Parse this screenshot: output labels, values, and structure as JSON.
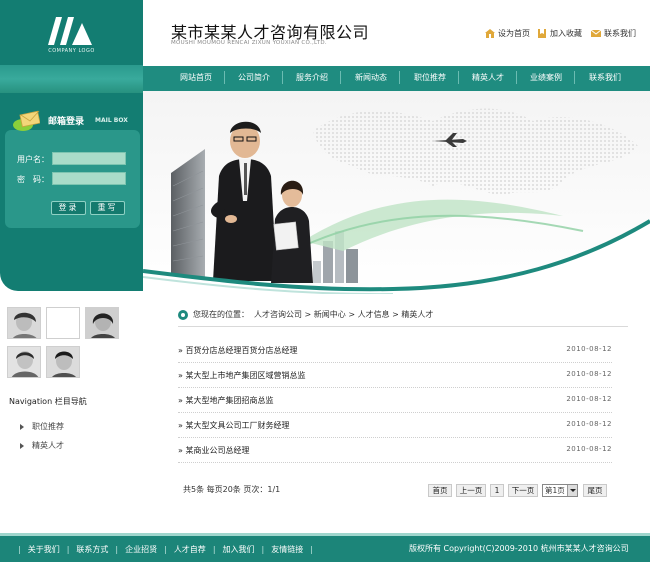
{
  "brand": {
    "logo_text": "COMPANY LOGO",
    "company_name": "某市某某人才咨询有限公司",
    "company_sub": "MOUSHI MOUMOU RENCAI ZIXUN YOUXIAN CO.,LTD.",
    "accent": "#137d72"
  },
  "toplinks": [
    {
      "label": "设为首页",
      "icon": "home-icon"
    },
    {
      "label": "加入收藏",
      "icon": "bookmark-icon"
    },
    {
      "label": "联系我们",
      "icon": "mail-icon"
    }
  ],
  "nav": [
    "网站首页",
    "公司简介",
    "服务介绍",
    "新闻动态",
    "职位推荐",
    "精英人才",
    "业绩案例",
    "联系我们"
  ],
  "login": {
    "title": "邮箱登录",
    "title_en": "MAIL BOX",
    "username_label": "用户名：",
    "password_label": "密　码：",
    "username_value": "",
    "password_value": "",
    "login_button": "登录",
    "reset_button": "重写"
  },
  "sidebar": {
    "nav_heading": "Navigation  栏目导航",
    "items": [
      "职位推荐",
      "精英人才"
    ]
  },
  "breadcrumb": {
    "prefix": "您现在的位置：",
    "trail": "人才咨询公司 > 新闻中心 > 人才信息 > 精英人才"
  },
  "jobs": [
    {
      "title": "百货分店总经理百货分店总经理",
      "date": "2010-08-12"
    },
    {
      "title": "某大型上市地产集团区域营销总监",
      "date": "2010-08-12"
    },
    {
      "title": "某大型地产集团招商总监",
      "date": "2010-08-12"
    },
    {
      "title": "某大型文具公司工厂财务经理",
      "date": "2010-08-12"
    },
    {
      "title": "某商业公司总经理",
      "date": "2010-08-12"
    }
  ],
  "pagination": {
    "info": "共5条  每页20条  页次：1/1",
    "first": "首页",
    "prev": "上一页",
    "current": "1",
    "next": "下一页",
    "select_value": "第1页",
    "last": "尾页"
  },
  "footer": {
    "links": [
      "关于我们",
      "联系方式",
      "企业招贤",
      "人才自荐",
      "加入我们",
      "友情链接"
    ],
    "copyright": "版权所有  Copyright(C)2009-2010 杭州市某某人才咨询公司"
  }
}
